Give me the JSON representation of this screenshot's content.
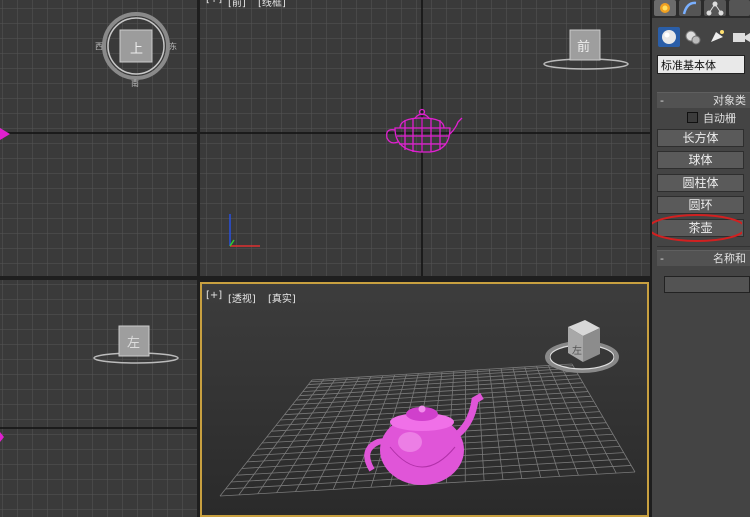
{
  "viewports": {
    "top": {
      "gizmo_labels": {
        "center": "上",
        "left": "西",
        "right": "东",
        "bottom": "南"
      }
    },
    "front": {
      "label_parts": [
        "[+]",
        "[前]",
        "[线框]"
      ],
      "cube_label": "前"
    },
    "left": {
      "cube_label": "左"
    },
    "perspective": {
      "label_parts": [
        "[+]",
        "[透视]",
        "[真实]"
      ],
      "cube_label": "左"
    }
  },
  "command_panel": {
    "dropdown_value": "标准基本体",
    "object_type_title": "对象类",
    "autogrid_label": "自动栅",
    "buttons": [
      "长方体",
      "球体",
      "圆柱体",
      "圆环",
      "茶壶"
    ],
    "name_color_title": "名称和"
  },
  "colors": {
    "selection": "#e020d0",
    "active_border": "#c8a040",
    "annotation_circle": "#d22020",
    "grid_line": "#5a5a5a",
    "viewport_bg": "#3a3a3a"
  },
  "icons": [
    "create-tab-icon",
    "modify-tab-icon",
    "hierarchy-tab-icon",
    "geometry-icon",
    "shapes-icon",
    "lights-icon",
    "cameras-icon"
  ]
}
